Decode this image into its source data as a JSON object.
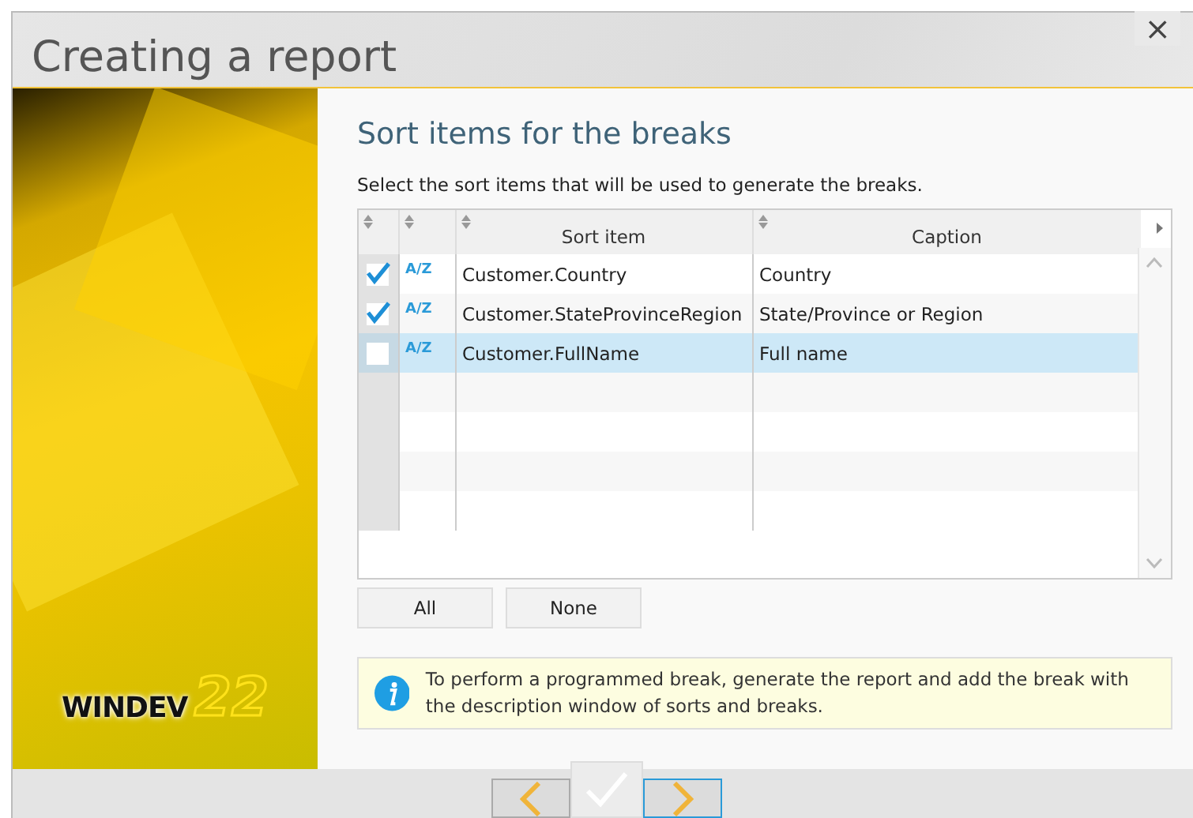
{
  "window": {
    "title": "Creating a report",
    "close": "×"
  },
  "logo": {
    "brand": "WINDEV",
    "version": "22"
  },
  "step": {
    "title": "Sort items for the breaks",
    "instruction": "Select the sort items that will be used to generate the breaks."
  },
  "grid": {
    "columns": [
      "Sort item",
      "Caption"
    ],
    "rows": [
      {
        "checked": true,
        "order": "A/Z",
        "sort_item": "Customer.Country",
        "caption": "Country",
        "selected": false
      },
      {
        "checked": true,
        "order": "A/Z",
        "sort_item": "Customer.StateProvinceRegion",
        "caption": "State/Province or Region",
        "selected": false
      },
      {
        "checked": false,
        "order": "A/Z",
        "sort_item": "Customer.FullName",
        "caption": "Full name",
        "selected": true
      }
    ]
  },
  "buttons": [
    "All",
    "None"
  ],
  "note": "To perform a programmed break, generate the report and add the break with the description window of sorts and breaks.",
  "nav": [
    {
      "kind": "previous",
      "disabled": false,
      "focused": false
    },
    {
      "kind": "finish",
      "disabled": true,
      "focused": false
    },
    {
      "kind": "next",
      "disabled": false,
      "focused": true
    }
  ]
}
